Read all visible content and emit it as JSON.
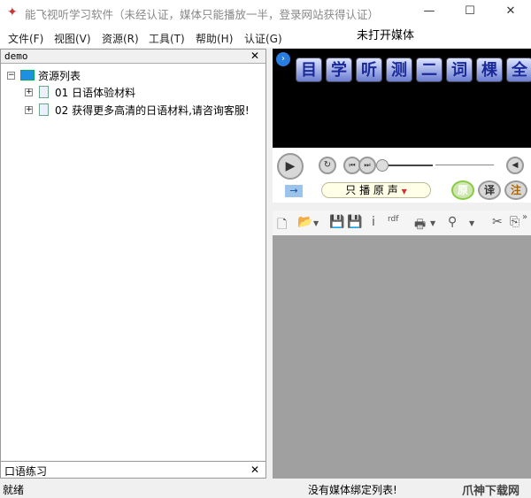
{
  "window": {
    "title": "能飞视听学习软件（未经认证，媒体只能播放一半，登录网站获得认证）",
    "minimize": "—",
    "maximize": "☐",
    "close": "✕"
  },
  "menu": [
    "文件(F)",
    "视图(V)",
    "资源(R)",
    "工具(T)",
    "帮助(H)",
    "认证(G)"
  ],
  "media_title": "未打开媒体",
  "left_panel": {
    "title": "demo",
    "close": "✕",
    "tree_root": "资源列表",
    "items": [
      "01 日语体验材料",
      "02 获得更多高清的日语材料,请咨询客服!"
    ]
  },
  "bottom_panel": {
    "title": "口语练习",
    "close": "✕"
  },
  "video_buttons": [
    "目",
    "学",
    "听",
    "测",
    "二",
    "词",
    "棵",
    "全"
  ],
  "play_mode": "只 播 原 声",
  "lang_buttons": [
    "原",
    "译",
    "注"
  ],
  "status": {
    "left": "就绪",
    "right": "没有媒体绑定列表!",
    "watermark": "爪神下载网"
  }
}
